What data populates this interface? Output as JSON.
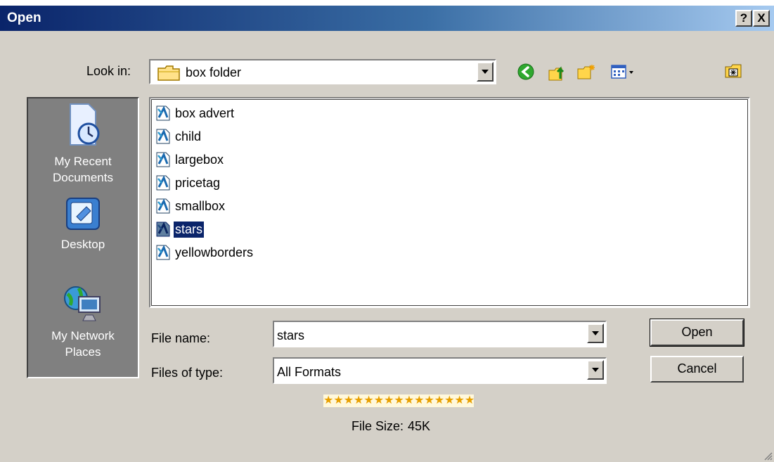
{
  "window": {
    "title": "Open",
    "help_label": "?",
    "close_label": "X"
  },
  "toolbar": {
    "look_in_label": "Look in:",
    "look_in_value": "box folder",
    "icons": [
      "back-icon",
      "up-folder-icon",
      "new-folder-icon",
      "views-icon",
      "desktop-icon"
    ]
  },
  "places": [
    {
      "label_line1": "My Recent",
      "label_line2": "Documents",
      "icon": "recent-documents-icon"
    },
    {
      "label_line1": "Desktop",
      "label_line2": "",
      "icon": "desktop-icon"
    },
    {
      "label_line1": "My Network",
      "label_line2": "Places",
      "icon": "network-places-icon"
    }
  ],
  "files": [
    {
      "name": "box advert",
      "selected": false
    },
    {
      "name": "child",
      "selected": false
    },
    {
      "name": "largebox",
      "selected": false
    },
    {
      "name": "pricetag",
      "selected": false
    },
    {
      "name": "smallbox",
      "selected": false
    },
    {
      "name": "stars",
      "selected": true
    },
    {
      "name": "yellowborders",
      "selected": false
    }
  ],
  "form": {
    "file_name_label": "File name:",
    "file_name_value": "stars",
    "file_type_label": "Files of type:",
    "file_type_value": "All Formats"
  },
  "buttons": {
    "open": "Open",
    "cancel": "Cancel"
  },
  "preview": {
    "stars": "★★★★★★★★★★★★★★★",
    "file_size_label": "File Size:",
    "file_size_value": "45K"
  },
  "colors": {
    "title_start": "#0a246a",
    "title_end": "#a6caf0",
    "face": "#d4d0c8",
    "selection": "#0a246a"
  }
}
